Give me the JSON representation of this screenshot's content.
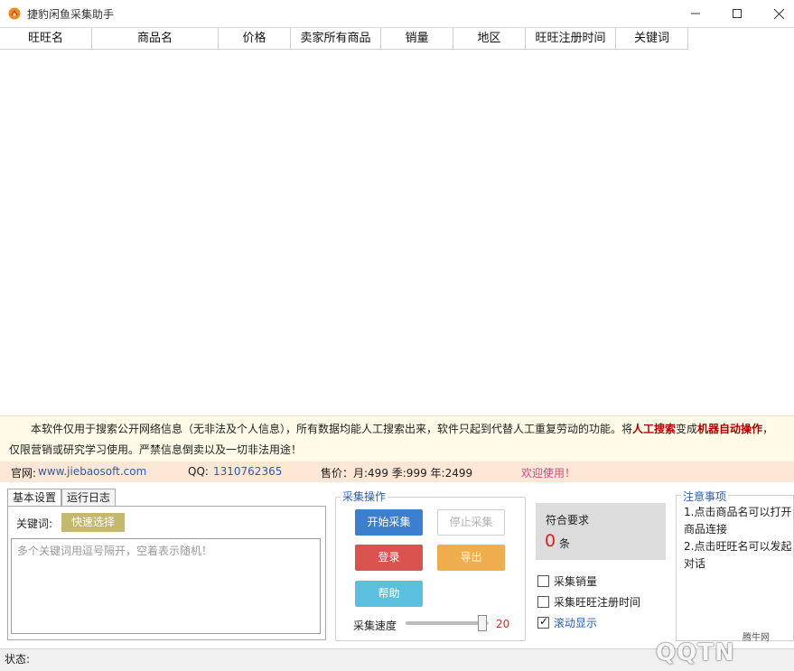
{
  "window": {
    "title": "捷豹闲鱼采集助手"
  },
  "grid": {
    "columns": [
      "旺旺名",
      "商品名",
      "价格",
      "卖家所有商品",
      "销量",
      "地区",
      "旺旺注册时间",
      "关键词"
    ]
  },
  "notice": {
    "line1_pre": "本软件仅用于搜索公开网络信息（无非法及个人信息），所有数据均能人工搜索出来，软件只起到代替人工重复劳动的功能。将",
    "line1_em1": "人工搜索",
    "line1_mid": "变成",
    "line1_em2": "机器自动操作",
    "line1_post": "，",
    "line2": "仅限营销或研究学习使用。严禁信息倒卖以及一切非法用途！"
  },
  "info": {
    "site_label": "官网:",
    "site_url": "www.jiebaosoft.com",
    "qq_label": "QQ:",
    "qq_value": "1310762365",
    "price": "售价：月:499  季:999  年:2499",
    "welcome": "欢迎使用！"
  },
  "tabs": [
    {
      "label": "基本设置",
      "active": true
    },
    {
      "label": "运行日志",
      "active": false
    }
  ],
  "settings": {
    "keyword_label": "关键词:",
    "quick_select": "快速选择",
    "keyword_value": "",
    "keyword_placeholder": "多个关键词用逗号隔开，空着表示随机！"
  },
  "ops": {
    "legend": "采集操作",
    "start": "开始采集",
    "stop": "停止采集",
    "login": "登录",
    "export": "导出",
    "help": "帮助",
    "speed_label": "采集速度",
    "speed_value": "20",
    "speed_fraction": 0.92
  },
  "result": {
    "label": "符合要求",
    "count": "0",
    "unit": "条"
  },
  "options": [
    {
      "label": "采集销量",
      "checked": false
    },
    {
      "label": "采集旺旺注册时间",
      "checked": false
    },
    {
      "label": "滚动显示",
      "checked": true
    }
  ],
  "notes": {
    "legend": "注意事项",
    "line1": "1.点击商品名可以打开商品连接",
    "line2": "2.点击旺旺名可以发起对话"
  },
  "status": {
    "label": "状态:"
  },
  "watermark": {
    "site": "腾牛网",
    "logo": "QQTN"
  },
  "colors": {
    "start": "#3c7fcf",
    "login": "#d9534f",
    "export": "#f0ad4e",
    "help": "#5bc0de",
    "quick": "#c3b86e",
    "info_bar": "#fce6d5",
    "notice_bg": "#fffbe8"
  }
}
